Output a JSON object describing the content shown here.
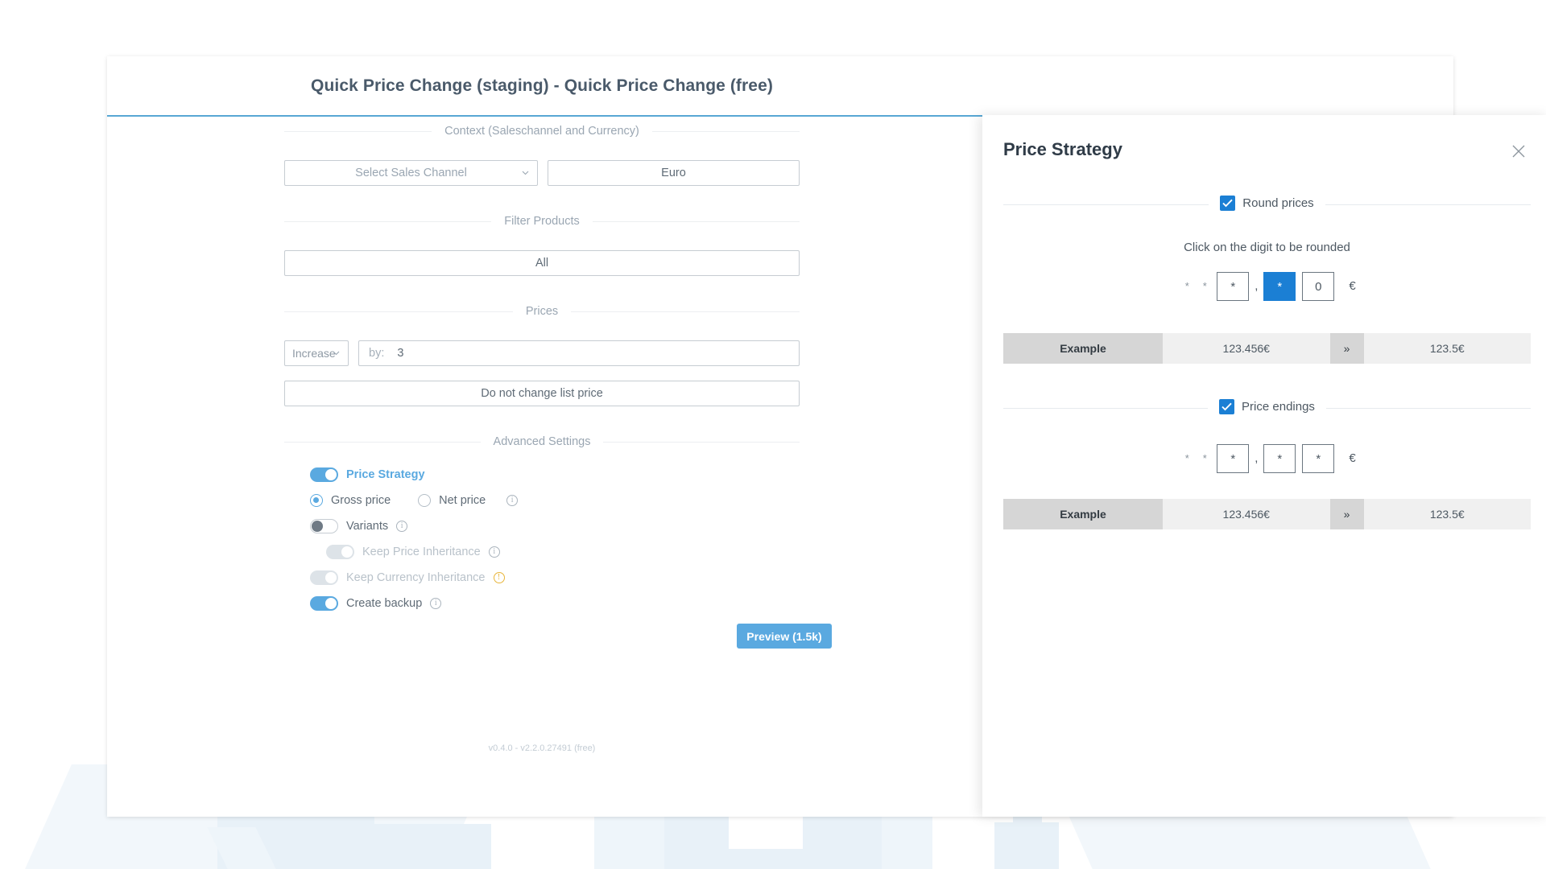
{
  "app": {
    "title": "Quick Price Change (staging) - Quick Price Change (free)",
    "version": "v0.4.0 - v2.2.0.27491 (free)"
  },
  "form": {
    "context_section_label": "Context (Saleschannel and Currency)",
    "sales_channel_placeholder": "Select Sales Channel",
    "currency_value": "Euro",
    "filter_section_label": "Filter Products",
    "filter_value": "All",
    "prices_section_label": "Prices",
    "direction_value": "Increase",
    "by_label": "by:",
    "by_value": "3",
    "list_price_value": "Do not change list price",
    "advanced_section_label": "Advanced Settings",
    "advanced": [
      {
        "name": "price-strategy",
        "label": "Price Strategy",
        "state": "on",
        "style": "accent",
        "info": false
      },
      {
        "name": "variants",
        "label": "Variants",
        "state": "off",
        "style": "normal",
        "info": true
      },
      {
        "name": "keep-price-inheritance",
        "label": "Keep Price Inheritance",
        "state": "disabled",
        "style": "muted",
        "info": true
      },
      {
        "name": "keep-currency-inheritance",
        "label": "Keep Currency Inheritance",
        "state": "disabled",
        "style": "muted",
        "info": "warn"
      },
      {
        "name": "create-backup",
        "label": "Create backup",
        "state": "on",
        "style": "normal",
        "info": true
      }
    ],
    "radios": [
      {
        "label": "Gross price",
        "selected": true
      },
      {
        "label": "Net price",
        "selected": false
      }
    ],
    "preview_button": "Preview (1.5k)"
  },
  "drawer": {
    "title": "Price Strategy",
    "close_label": "×",
    "round": {
      "checkbox_label": "Round prices",
      "checked": true,
      "hint": "Click on the digit to be rounded",
      "stars": [
        "*",
        "*"
      ],
      "digits": [
        {
          "value": "*",
          "selected": false
        },
        {
          "value": "*",
          "selected": true
        },
        {
          "value": "0",
          "selected": false
        }
      ],
      "comma": ",",
      "currency_symbol": "€",
      "example": {
        "label": "Example",
        "before": "123.456€",
        "arrow": "»",
        "after": "123.5€"
      }
    },
    "endings": {
      "checkbox_label": "Price endings",
      "checked": true,
      "stars": [
        "*",
        "*"
      ],
      "digits": [
        {
          "value": "*",
          "selected": false
        },
        {
          "value": "*",
          "selected": false
        },
        {
          "value": "*",
          "selected": false
        }
      ],
      "comma": ",",
      "currency_symbol": "€",
      "example": {
        "label": "Example",
        "before": "123.456€",
        "arrow": "»",
        "after": "123.5€"
      }
    }
  },
  "colors": {
    "accent": "#5aa9e0",
    "checkbox_blue": "#1b7fd4",
    "header_rule": "#58a7d4",
    "warn": "#e8b53a"
  }
}
